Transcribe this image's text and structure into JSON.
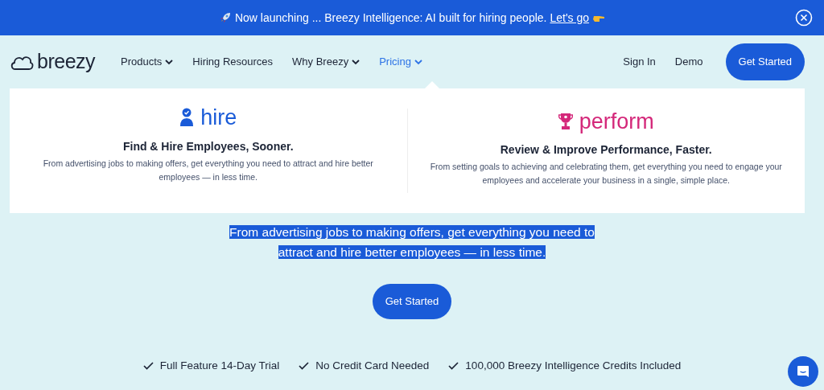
{
  "announcement": {
    "text": "Now launching ... Breezy Intelligence: AI built for hiring people.",
    "link": "Let's go"
  },
  "logo": {
    "text": "breezy"
  },
  "nav": [
    {
      "label": "Products",
      "has_menu": true,
      "selected": false
    },
    {
      "label": "Hiring Resources",
      "has_menu": false,
      "selected": false
    },
    {
      "label": "Why Breezy",
      "has_menu": true,
      "selected": false
    },
    {
      "label": "Pricing",
      "has_menu": true,
      "selected": true
    }
  ],
  "nav_right": {
    "sign_in": "Sign In",
    "demo": "Demo",
    "cta": "Get Started"
  },
  "pricing_menu": [
    {
      "kind": "hire",
      "brand": "hire",
      "title": "Find & Hire Employees, Sooner.",
      "description": "From advertising jobs to making offers, get everything you need to attract and hire better employees — in less time."
    },
    {
      "kind": "perform",
      "brand": "perform",
      "title": "Review & Improve Performance, Faster.",
      "description": "From setting goals to achieving and celebrating them, get everything you need to engage your employees and accelerate your business in a single, simple place."
    }
  ],
  "hero": {
    "text": "From advertising jobs to making offers, get everything you need to attract and hire better employees — in less time.",
    "highlighted": true,
    "cta": "Get Started"
  },
  "features": [
    "Full Feature 14-Day Trial",
    "No Credit Card Needed",
    "100,000 Breezy Intelligence Credits Included"
  ]
}
